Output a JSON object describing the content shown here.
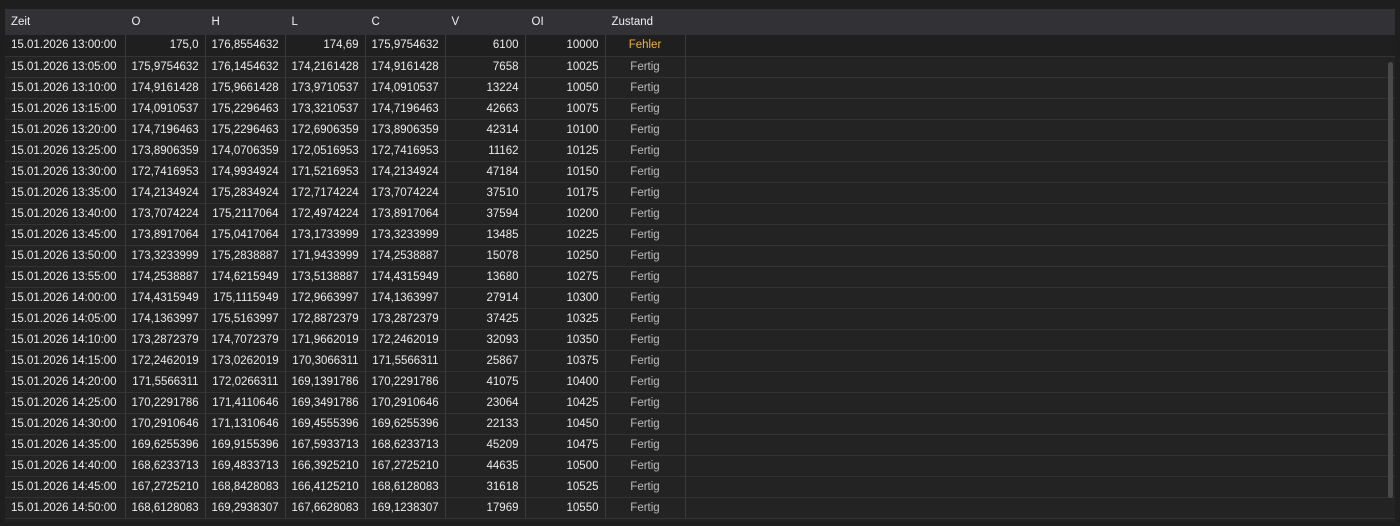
{
  "columns": {
    "zeit": "Zeit",
    "o": "O",
    "h": "H",
    "l": "L",
    "c": "C",
    "v": "V",
    "oi": "OI",
    "zustand": "Zustand"
  },
  "rows": [
    {
      "zeit": "15.01.2026 13:00:00",
      "o": "175,0",
      "h": "176,8554632",
      "l": "174,69",
      "c": "175,9754632",
      "v": "6100",
      "oi": "10000",
      "zustand": "Fehler"
    },
    {
      "zeit": "15.01.2026 13:05:00",
      "o": "175,9754632",
      "h": "176,1454632",
      "l": "174,2161428",
      "c": "174,9161428",
      "v": "7658",
      "oi": "10025",
      "zustand": "Fertig"
    },
    {
      "zeit": "15.01.2026 13:10:00",
      "o": "174,9161428",
      "h": "175,9661428",
      "l": "173,9710537",
      "c": "174,0910537",
      "v": "13224",
      "oi": "10050",
      "zustand": "Fertig"
    },
    {
      "zeit": "15.01.2026 13:15:00",
      "o": "174,0910537",
      "h": "175,2296463",
      "l": "173,3210537",
      "c": "174,7196463",
      "v": "42663",
      "oi": "10075",
      "zustand": "Fertig"
    },
    {
      "zeit": "15.01.2026 13:20:00",
      "o": "174,7196463",
      "h": "175,2296463",
      "l": "172,6906359",
      "c": "173,8906359",
      "v": "42314",
      "oi": "10100",
      "zustand": "Fertig"
    },
    {
      "zeit": "15.01.2026 13:25:00",
      "o": "173,8906359",
      "h": "174,0706359",
      "l": "172,0516953",
      "c": "172,7416953",
      "v": "11162",
      "oi": "10125",
      "zustand": "Fertig"
    },
    {
      "zeit": "15.01.2026 13:30:00",
      "o": "172,7416953",
      "h": "174,9934924",
      "l": "171,5216953",
      "c": "174,2134924",
      "v": "47184",
      "oi": "10150",
      "zustand": "Fertig"
    },
    {
      "zeit": "15.01.2026 13:35:00",
      "o": "174,2134924",
      "h": "175,2834924",
      "l": "172,7174224",
      "c": "173,7074224",
      "v": "37510",
      "oi": "10175",
      "zustand": "Fertig"
    },
    {
      "zeit": "15.01.2026 13:40:00",
      "o": "173,7074224",
      "h": "175,2117064",
      "l": "172,4974224",
      "c": "173,8917064",
      "v": "37594",
      "oi": "10200",
      "zustand": "Fertig"
    },
    {
      "zeit": "15.01.2026 13:45:00",
      "o": "173,8917064",
      "h": "175,0417064",
      "l": "173,1733999",
      "c": "173,3233999",
      "v": "13485",
      "oi": "10225",
      "zustand": "Fertig"
    },
    {
      "zeit": "15.01.2026 13:50:00",
      "o": "173,3233999",
      "h": "175,2838887",
      "l": "171,9433999",
      "c": "174,2538887",
      "v": "15078",
      "oi": "10250",
      "zustand": "Fertig"
    },
    {
      "zeit": "15.01.2026 13:55:00",
      "o": "174,2538887",
      "h": "174,6215949",
      "l": "173,5138887",
      "c": "174,4315949",
      "v": "13680",
      "oi": "10275",
      "zustand": "Fertig"
    },
    {
      "zeit": "15.01.2026 14:00:00",
      "o": "174,4315949",
      "h": "175,1115949",
      "l": "172,9663997",
      "c": "174,1363997",
      "v": "27914",
      "oi": "10300",
      "zustand": "Fertig"
    },
    {
      "zeit": "15.01.2026 14:05:00",
      "o": "174,1363997",
      "h": "175,5163997",
      "l": "172,8872379",
      "c": "173,2872379",
      "v": "37425",
      "oi": "10325",
      "zustand": "Fertig"
    },
    {
      "zeit": "15.01.2026 14:10:00",
      "o": "173,2872379",
      "h": "174,7072379",
      "l": "171,9662019",
      "c": "172,2462019",
      "v": "32093",
      "oi": "10350",
      "zustand": "Fertig"
    },
    {
      "zeit": "15.01.2026 14:15:00",
      "o": "172,2462019",
      "h": "173,0262019",
      "l": "170,3066311",
      "c": "171,5566311",
      "v": "25867",
      "oi": "10375",
      "zustand": "Fertig"
    },
    {
      "zeit": "15.01.2026 14:20:00",
      "o": "171,5566311",
      "h": "172,0266311",
      "l": "169,1391786",
      "c": "170,2291786",
      "v": "41075",
      "oi": "10400",
      "zustand": "Fertig"
    },
    {
      "zeit": "15.01.2026 14:25:00",
      "o": "170,2291786",
      "h": "171,4110646",
      "l": "169,3491786",
      "c": "170,2910646",
      "v": "23064",
      "oi": "10425",
      "zustand": "Fertig"
    },
    {
      "zeit": "15.01.2026 14:30:00",
      "o": "170,2910646",
      "h": "171,1310646",
      "l": "169,4555396",
      "c": "169,6255396",
      "v": "22133",
      "oi": "10450",
      "zustand": "Fertig"
    },
    {
      "zeit": "15.01.2026 14:35:00",
      "o": "169,6255396",
      "h": "169,9155396",
      "l": "167,5933713",
      "c": "168,6233713",
      "v": "45209",
      "oi": "10475",
      "zustand": "Fertig"
    },
    {
      "zeit": "15.01.2026 14:40:00",
      "o": "168,6233713",
      "h": "169,4833713",
      "l": "166,3925210",
      "c": "167,2725210",
      "v": "44635",
      "oi": "10500",
      "zustand": "Fertig"
    },
    {
      "zeit": "15.01.2026 14:45:00",
      "o": "167,2725210",
      "h": "168,8428083",
      "l": "166,4125210",
      "c": "168,6128083",
      "v": "31618",
      "oi": "10525",
      "zustand": "Fertig"
    },
    {
      "zeit": "15.01.2026 14:50:00",
      "o": "168,6128083",
      "h": "169,2938307",
      "l": "167,6628083",
      "c": "169,1238307",
      "v": "17969",
      "oi": "10550",
      "zustand": "Fertig"
    }
  ],
  "colors": {
    "error_state": "#f2b233",
    "header_bg": "#323236"
  }
}
